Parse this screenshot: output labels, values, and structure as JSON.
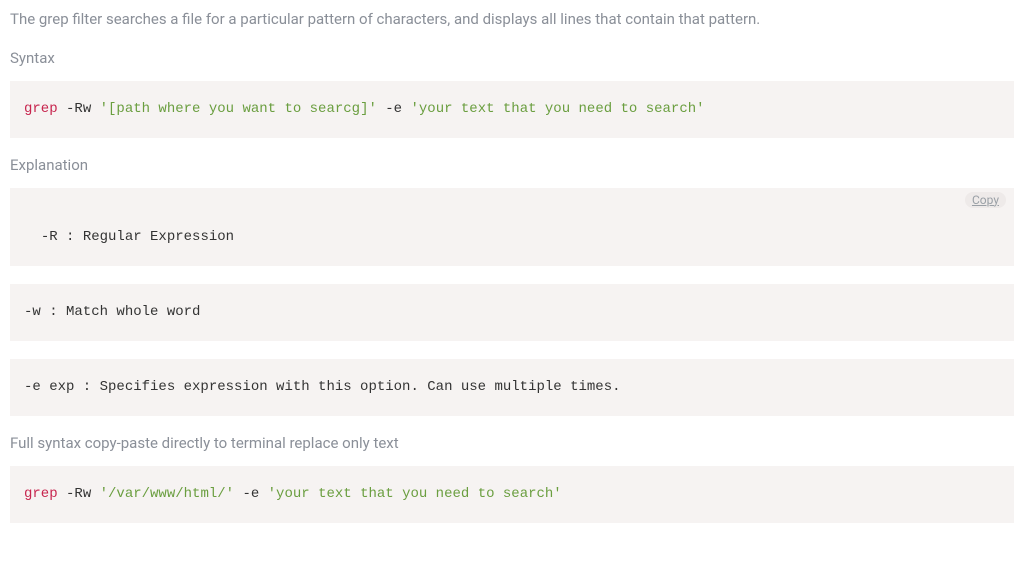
{
  "intro": "The grep filter searches a file for a particular pattern of characters, and displays all lines that contain that pattern.",
  "syntax_label": "Syntax",
  "syntax_code": {
    "cmd": "grep",
    "flags1": " -Rw ",
    "str1": "'[path where you want to searcg]'",
    "flags2": " -e ",
    "str2": "'your text that you need to search'"
  },
  "explanation_label": "Explanation",
  "explanations": [
    "-R : Regular Expression",
    "-w : Match whole word",
    "-e exp : Specifies expression with this option. Can use multiple times."
  ],
  "copy_label": "Copy",
  "full_syntax_label": "Full syntax copy-paste directly to terminal replace only text",
  "full_code": {
    "cmd": "grep",
    "flags1": " -Rw ",
    "str1": "'/var/www/html/'",
    "flags2": " -e ",
    "str2": "'your text that you need to search'"
  }
}
